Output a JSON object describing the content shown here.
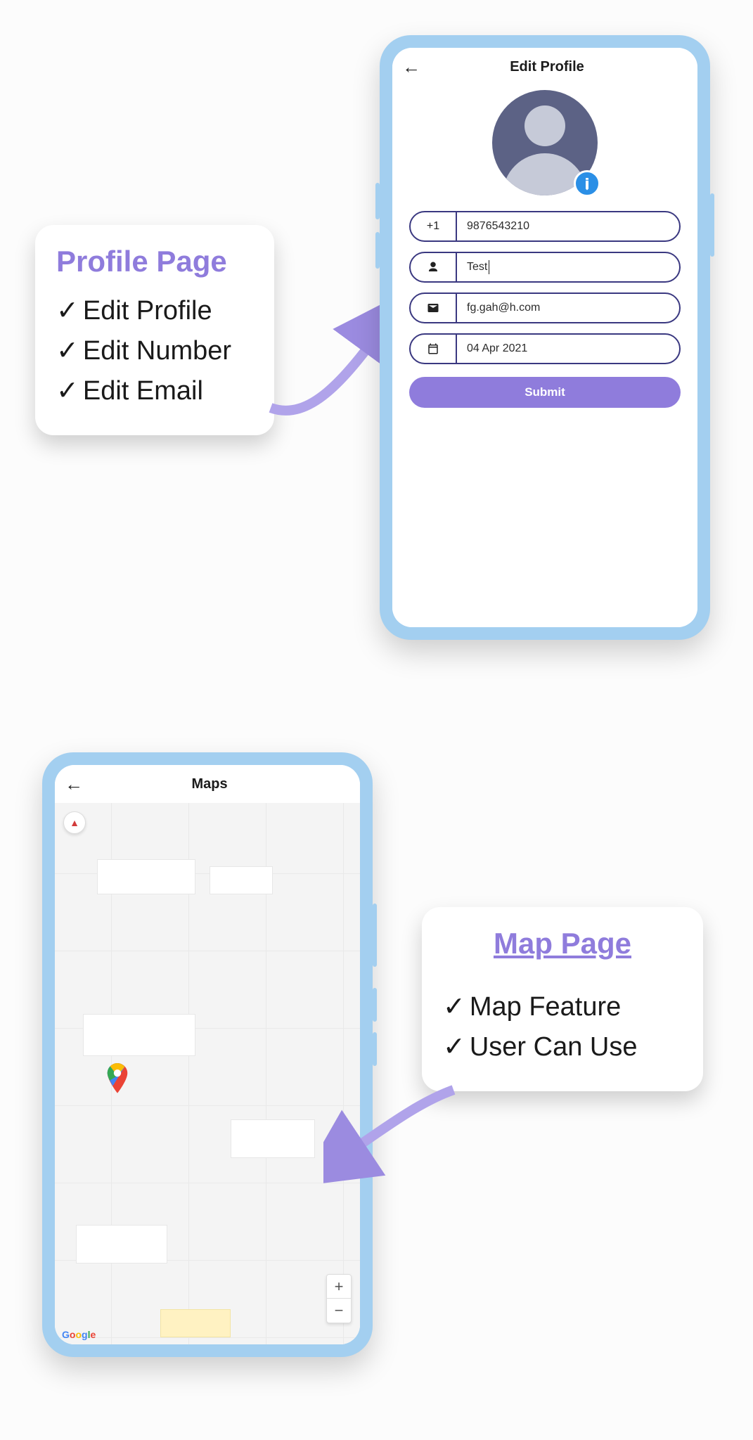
{
  "annotations": {
    "profile": {
      "title": "Profile Page",
      "items": [
        "Edit Profile",
        "Edit Number",
        "Edit Email"
      ]
    },
    "map": {
      "title": "Map Page",
      "items": [
        "Map Feature",
        "User Can Use"
      ]
    }
  },
  "phone_profile": {
    "header_title": "Edit Profile",
    "form": {
      "country_code": "+1",
      "phone": "9876543210",
      "name": "Test",
      "email": "fg.gah@h.com",
      "date": "04 Apr 2021",
      "submit_label": "Submit"
    }
  },
  "phone_map": {
    "header_title": "Maps",
    "zoom_in": "+",
    "zoom_out": "−",
    "attribution": "Google"
  }
}
